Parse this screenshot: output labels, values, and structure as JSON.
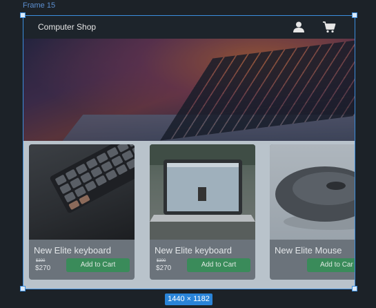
{
  "editor": {
    "frame_label": "Frame 15",
    "size_badge": "1440 × 1182",
    "selection_color": "#3c8fe0"
  },
  "header": {
    "brand": "Computer Shop",
    "icons": [
      "user-icon",
      "cart-icon"
    ]
  },
  "hero": {
    "image": "laptop-keyboard-hero"
  },
  "products": [
    {
      "name": "New Elite keyboard",
      "old_price": "$300",
      "price": "$270",
      "button": "Add to Cart",
      "image": "mechanical-keyboard"
    },
    {
      "name": "New Elite keyboard",
      "old_price": "$300",
      "price": "$270",
      "button": "Add to Cart",
      "image": "laptop-on-table"
    },
    {
      "name": "New Elite Mouse",
      "old_price": "",
      "price": "",
      "button": "Add to Car",
      "image": "computer-mouse"
    }
  ],
  "colors": {
    "button": "#3a8b5a",
    "topbar": "#1d242b",
    "card": "#6b737b"
  }
}
